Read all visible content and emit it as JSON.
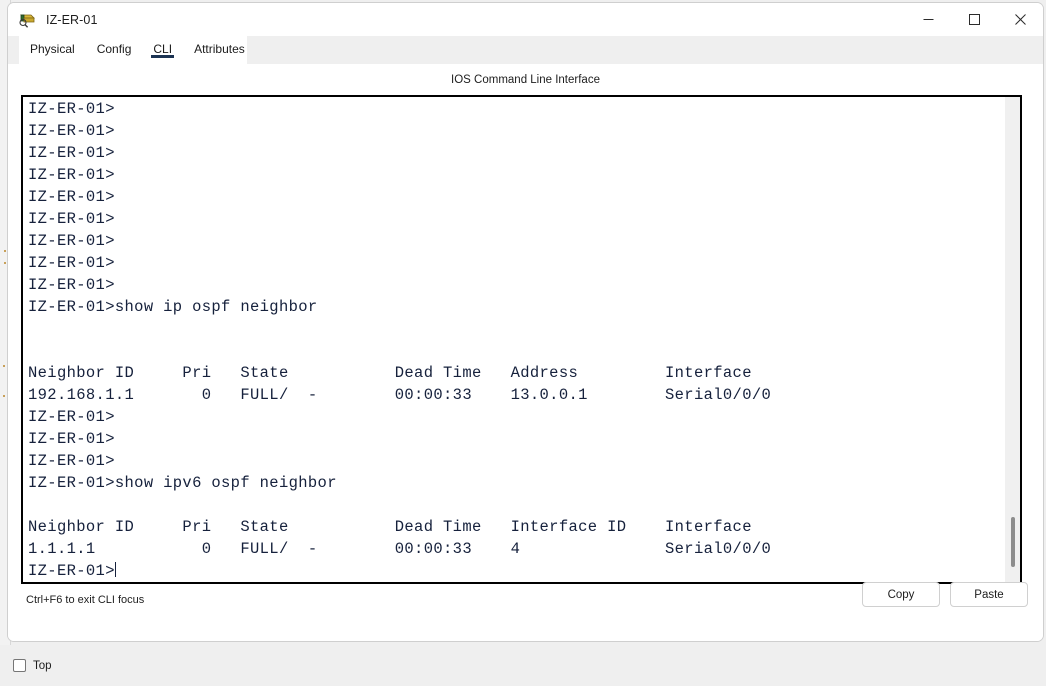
{
  "window": {
    "title": "IZ-ER-01",
    "icon": "router-device-icon",
    "controls": [
      {
        "name": "minimize-button",
        "glyph": "minimize-icon"
      },
      {
        "name": "maximize-button",
        "glyph": "maximize-icon"
      },
      {
        "name": "close-button",
        "glyph": "close-icon"
      }
    ]
  },
  "tabs": [
    {
      "label": "Physical",
      "active": false
    },
    {
      "label": "Config",
      "active": false
    },
    {
      "label": "CLI",
      "active": true
    },
    {
      "label": "Attributes",
      "active": false
    }
  ],
  "panel": {
    "caption": "IOS Command Line Interface"
  },
  "terminal": {
    "prompt": "IZ-ER-01>",
    "lines": [
      "IZ-ER-01>",
      "IZ-ER-01>",
      "IZ-ER-01>",
      "IZ-ER-01>",
      "IZ-ER-01>",
      "IZ-ER-01>",
      "IZ-ER-01>",
      "IZ-ER-01>",
      "IZ-ER-01>",
      "IZ-ER-01>show ip ospf neighbor",
      "",
      "",
      "Neighbor ID     Pri   State           Dead Time   Address         Interface",
      "192.168.1.1       0   FULL/  -        00:00:33    13.0.0.1        Serial0/0/0",
      "IZ-ER-01>",
      "IZ-ER-01>",
      "IZ-ER-01>",
      "IZ-ER-01>show ipv6 ospf neighbor",
      "",
      "Neighbor ID     Pri   State           Dead Time   Interface ID    Interface",
      "1.1.1.1           0   FULL/  -        00:00:33    4               Serial0/0/0"
    ],
    "last_line": "IZ-ER-01>",
    "commands": [
      "show ip ospf neighbor",
      "show ipv6 ospf neighbor"
    ],
    "ipv4_neighbors": {
      "headers": [
        "Neighbor ID",
        "Pri",
        "State",
        "Dead Time",
        "Address",
        "Interface"
      ],
      "rows": [
        [
          "192.168.1.1",
          "0",
          "FULL/  -",
          "00:00:33",
          "13.0.0.1",
          "Serial0/0/0"
        ]
      ]
    },
    "ipv6_neighbors": {
      "headers": [
        "Neighbor ID",
        "Pri",
        "State",
        "Dead Time",
        "Interface ID",
        "Interface"
      ],
      "rows": [
        [
          "1.1.1.1",
          "0",
          "FULL/  -",
          "00:00:33",
          "4",
          "Serial0/0/0"
        ]
      ]
    },
    "text_color": "#16213c"
  },
  "footer": {
    "hint": "Ctrl+F6 to exit CLI focus",
    "copy_label": "Copy",
    "paste_label": "Paste"
  },
  "bottom": {
    "top_label": "Top",
    "top_checked": false
  },
  "colors": {
    "accent": "#1b3352",
    "window_bg": "#ffffff",
    "chrome_bg": "#efefef",
    "terminal_border": "#000000"
  }
}
